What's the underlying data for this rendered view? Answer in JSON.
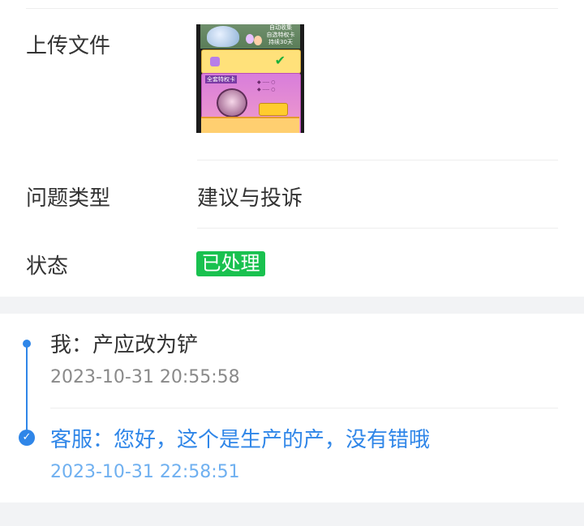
{
  "details": {
    "upload_label": "上传文件",
    "issue_type_label": "问题类型",
    "issue_type_value": "建议与投诉",
    "status_label": "状态",
    "status_value": "已处理",
    "status_color": "#19c14f"
  },
  "thumbnail": {
    "banner_text_1": "自动收集",
    "banner_text_2": "自选特权卡",
    "banner_text_3": "持续30天",
    "card_title": "全套特权卡"
  },
  "conversation": {
    "user_message": "我：产应改为铲",
    "user_time": "2023-10-31 20:55:58",
    "service_message": "客服：您好，这个是生产的产，没有错哦",
    "service_time": "2023-10-31 22:58:51",
    "accent_color": "#2f86e8"
  }
}
